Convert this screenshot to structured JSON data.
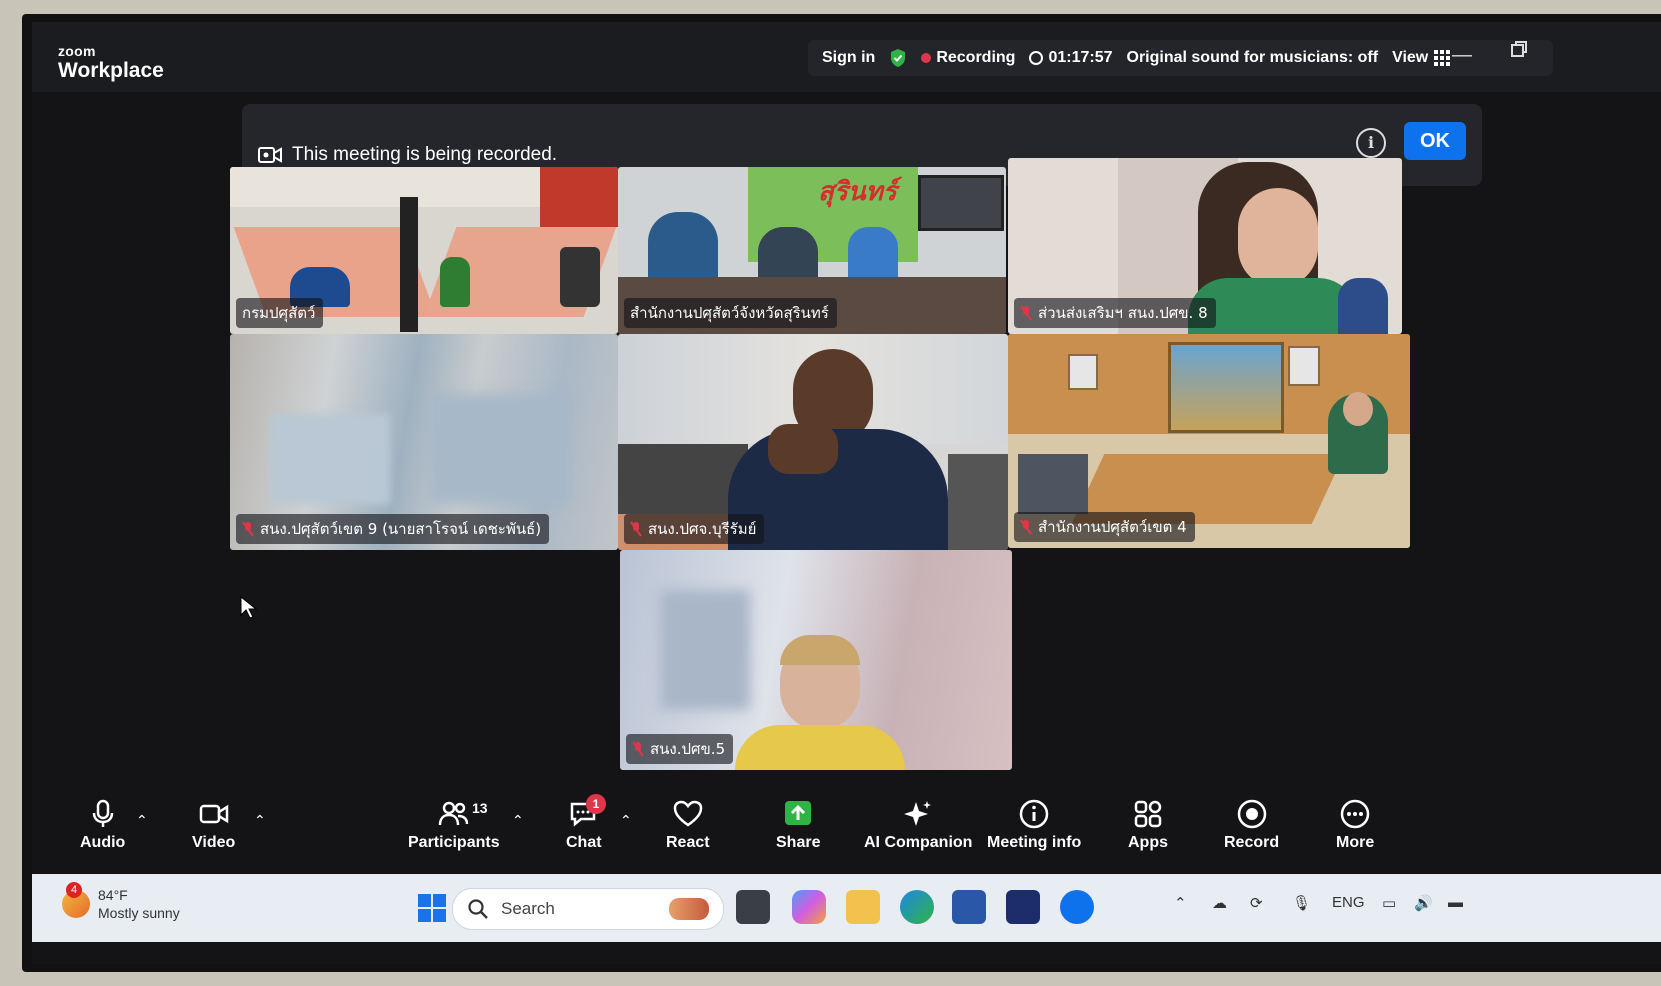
{
  "app": {
    "brand_small": "zoom",
    "brand_big": "Workplace"
  },
  "status": {
    "sign_in": "Sign in",
    "recording": "Recording",
    "elapsed": "01:17:57",
    "original_sound": "Original sound for musicians: off",
    "view": "View"
  },
  "banner": {
    "message": "This meeting is being recorded.",
    "info": "i",
    "ok": "OK"
  },
  "tiles": [
    {
      "label": "กรมปศุสัตว์"
    },
    {
      "label": "สำนักงานปศุสัตว์จังหวัดสุรินทร์",
      "sign_text": "สุรินทร์"
    },
    {
      "label": "ส่วนส่งเสริมฯ สนง.ปศข. 8"
    },
    {
      "label": "สนง.ปศุสัตว์เขต 9 (นายสาโรจน์ เดชะพันธ์)"
    },
    {
      "label": "สนง.ปศจ.บุรีรัมย์"
    },
    {
      "label": "สำนักงานปศุสัตว์เขต 4"
    },
    {
      "label": "สนง.ปศข.5"
    }
  ],
  "toolbar": {
    "audio": "Audio",
    "video": "Video",
    "participants": "Participants",
    "participants_count": "13",
    "chat": "Chat",
    "chat_badge": "1",
    "react": "React",
    "share": "Share",
    "ai_companion": "AI Companion",
    "meeting_info": "Meeting info",
    "apps": "Apps",
    "record": "Record",
    "more": "More"
  },
  "taskbar": {
    "weather_badge": "4",
    "temperature": "84°F",
    "condition": "Mostly sunny",
    "search_label": "Search",
    "language": "ENG"
  },
  "colors": {
    "accent": "#0e72ed",
    "record_red": "#e0364c",
    "share_green": "#2fb344",
    "screen_bg": "#141417"
  }
}
